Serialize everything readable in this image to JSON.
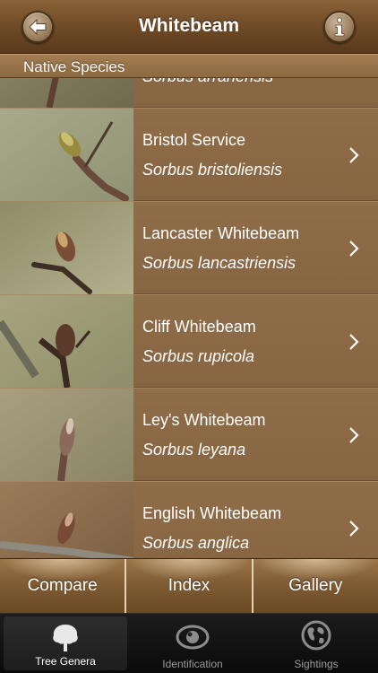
{
  "header": {
    "title": "Whitebeam",
    "back_icon": "back-arrow-icon",
    "info_icon": "info-icon"
  },
  "section": {
    "title": "Native Species"
  },
  "list": {
    "items": [
      {
        "common": "",
        "latin": "Sorbus arranensis"
      },
      {
        "common": "Bristol Service",
        "latin": "Sorbus bristoliensis"
      },
      {
        "common": "Lancaster Whitebeam",
        "latin": "Sorbus lancastriensis"
      },
      {
        "common": "Cliff Whitebeam",
        "latin": "Sorbus rupicola"
      },
      {
        "common": "Ley's Whitebeam",
        "latin": "Sorbus leyana"
      },
      {
        "common": "English Whitebeam",
        "latin": "Sorbus anglica"
      }
    ]
  },
  "segments": {
    "compare": "Compare",
    "index": "Index",
    "gallery": "Gallery"
  },
  "tabs": [
    {
      "label": "Tree Genera",
      "icon": "tree-icon",
      "selected": true
    },
    {
      "label": "Identification",
      "icon": "eye-icon",
      "selected": false
    },
    {
      "label": "Sightings",
      "icon": "globe-icon",
      "selected": false
    }
  ]
}
